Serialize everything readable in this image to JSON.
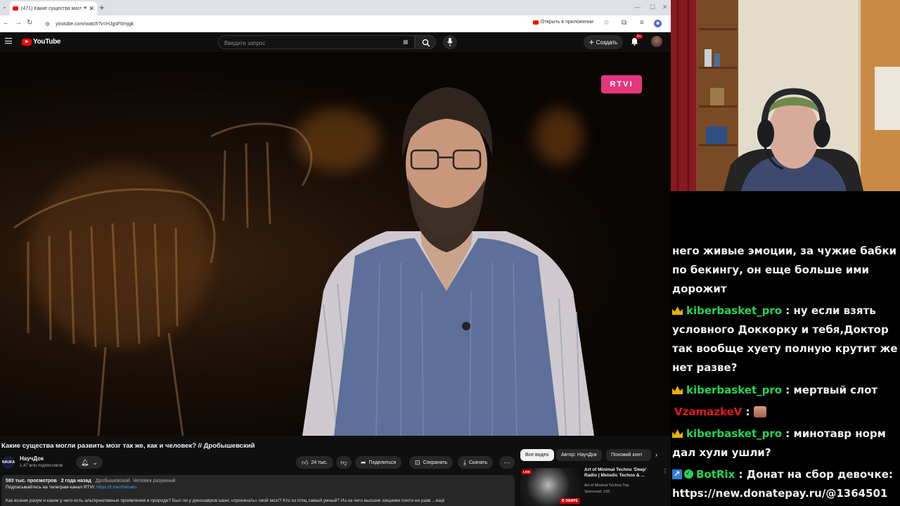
{
  "browser": {
    "tab_title": "(471) Какие существа могли",
    "url": "youtube.com/watch?v=HJgsF0rnjgk",
    "open_in_app": "Открыть в приложении"
  },
  "youtube": {
    "brand": "YouTube",
    "search_placeholder": "Введите запрос",
    "create_label": "Создать",
    "notifications_badge": "9+",
    "video_overlay_logo": "RTVI",
    "video_title": "Какие существа могли развить мозг так же, как и человек? // Дробышевский",
    "channel_avatar_text": "NAUKA",
    "channel_name": "НаучДок",
    "subscribers": "1,47 млн подписчиков",
    "actions": {
      "likes": "24 тыс.",
      "share": "Поделиться",
      "save": "Сохранить",
      "download": "Скачать"
    },
    "description": {
      "views": "593 тыс. просмотров",
      "age": "2 года назад",
      "tags": "Дробышевский. Человек разумный",
      "telegram_text": "Подписывайтесь на телеграм-канал RTVI:",
      "telegram_link": "https://t.me/rtvimain",
      "body": "Как возник разум и какие у него есть альтернативные проявления в природе? Был ли у динозавров шанс «прокачать» свой мозг? Кто из птиц самый умный? Из-за чего высшие хищники почти не разв ...ещё"
    },
    "chips": [
      "Все видео",
      "Автор: НаучДок",
      "Похожий конт"
    ],
    "recommendation": {
      "title": "Art of Minimal Techno 'Deep' Radio | Melodic Techno & ...",
      "channel": "Art of Minimal Techno Trip",
      "viewers": "Зрителей: 165",
      "live_badge": "В ЭФИРЕ",
      "live_top": "LIVE"
    }
  },
  "chat": {
    "messages": [
      {
        "text": "него живые эмоции, за чужие бабки по бекингу, он еще больше ими дорожит"
      },
      {
        "user": "kiberbasket_pro",
        "text": "ну если взять условного Доккорку и тебя,Доктор так вообще хуету полную крутит же нет разве?"
      },
      {
        "user": "kiberbasket_pro",
        "text": "мертвый слот"
      },
      {
        "user": "VzamazkeV",
        "text": ""
      },
      {
        "user": "kiberbasket_pro",
        "text": "минотавр норм дал хули ушли?"
      },
      {
        "user": "BotRix",
        "text": "Донат на сбор девочке: https://new.donatepay.ru/@1364501"
      }
    ]
  },
  "colors": {
    "chat_username": "#22d655",
    "chat_username_alt": "#e01b1b",
    "youtube_red": "#ff0000",
    "overlay_pink": "#e5357c"
  }
}
